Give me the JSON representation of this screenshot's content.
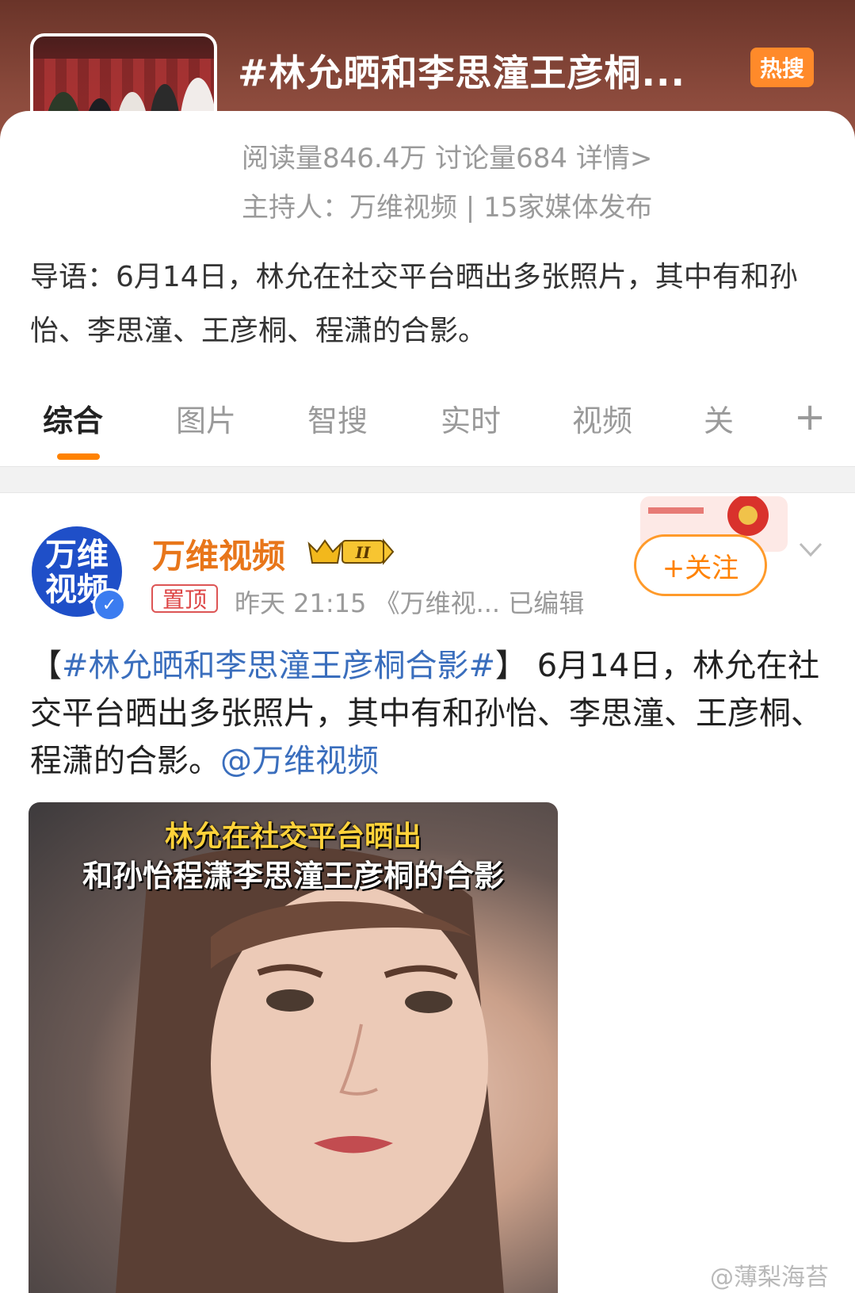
{
  "header": {
    "title": "#林允晒和李思潼王彦桐...",
    "hot_badge": "热搜"
  },
  "topic": {
    "stats": "阅读量846.4万  讨论量684  详情>",
    "host": "主持人：万维视频 | 15家媒体发布",
    "lead": "导语：6月14日，林允在社交平台晒出多张照片，其中有和孙怡、李思潼、王彦桐、程潇的合影。"
  },
  "tabs": [
    {
      "label": "综合",
      "active": true
    },
    {
      "label": "图片"
    },
    {
      "label": "智搜"
    },
    {
      "label": "实时"
    },
    {
      "label": "视频"
    },
    {
      "label": "关"
    }
  ],
  "tab_add": "+",
  "post": {
    "avatar_text": "万维视频",
    "author": "万维视频",
    "vip_level": "II",
    "pin_label": "置顶",
    "meta": "昨天 21:15   《万维视...   已编辑",
    "follow_label": "+关注",
    "text_prefix": "【",
    "hashtag": "#林允晒和李思潼王彦桐合影#",
    "text_body": "】 6月14日，林允在社交平台晒出多张照片，其中有和孙怡、李思潼、王彦桐、程潇的合影。",
    "mention": "@万维视频",
    "image_caption_line1": "林允在社交平台晒出",
    "image_caption_line2": "和孙怡程潇李思潼王彦桐的合影"
  },
  "watermark": "@薄梨海苔",
  "colors": {
    "accent": "#ff8200",
    "link": "#3a6ebd",
    "header_bg": "#7a3f33"
  }
}
